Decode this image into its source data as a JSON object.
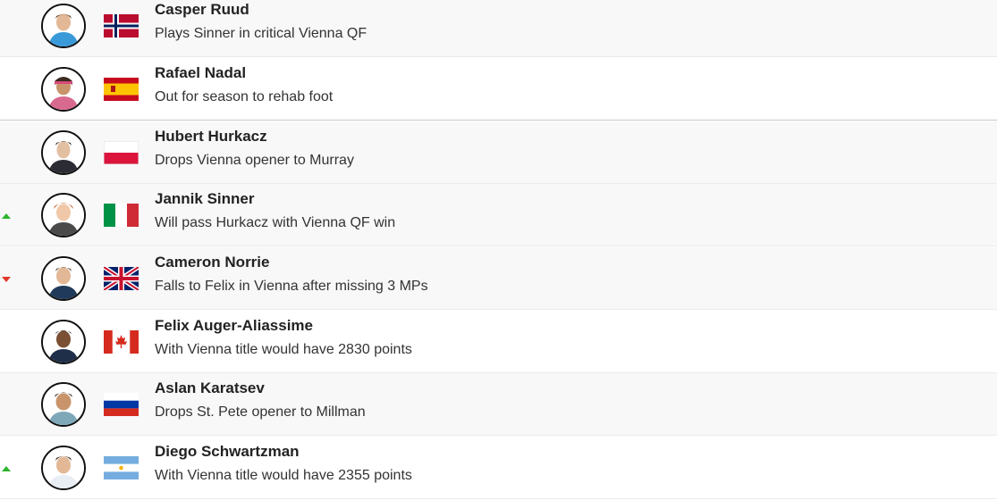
{
  "players": [
    {
      "name": "Casper Ruud",
      "note": "Plays Sinner in critical Vienna QF",
      "flag": "norway-flag",
      "movement": "none"
    },
    {
      "name": "Rafael Nadal",
      "note": "Out for season to rehab foot",
      "flag": "spain-flag",
      "movement": "none"
    },
    {
      "name": "Hubert Hurkacz",
      "note": "Drops Vienna opener to Murray",
      "flag": "poland-flag",
      "movement": "none"
    },
    {
      "name": "Jannik Sinner",
      "note": "Will pass Hurkacz with Vienna QF win",
      "flag": "italy-flag",
      "movement": "up"
    },
    {
      "name": "Cameron Norrie",
      "note": "Falls to Felix in Vienna after missing 3 MPs",
      "flag": "uk-flag",
      "movement": "down"
    },
    {
      "name": "Felix Auger-Aliassime",
      "note": "With Vienna title would have 2830 points",
      "flag": "canada-flag",
      "movement": "none"
    },
    {
      "name": "Aslan Karatsev",
      "note": "Drops St. Pete opener to Millman",
      "flag": "russia-flag",
      "movement": "none"
    },
    {
      "name": "Diego Schwartzman",
      "note": "With Vienna title would have 2355 points",
      "flag": "argentina-flag",
      "movement": "up"
    }
  ],
  "colors": {
    "up": "#2db52d",
    "down": "#e0382a",
    "row_alt": "#f8f8f8"
  }
}
